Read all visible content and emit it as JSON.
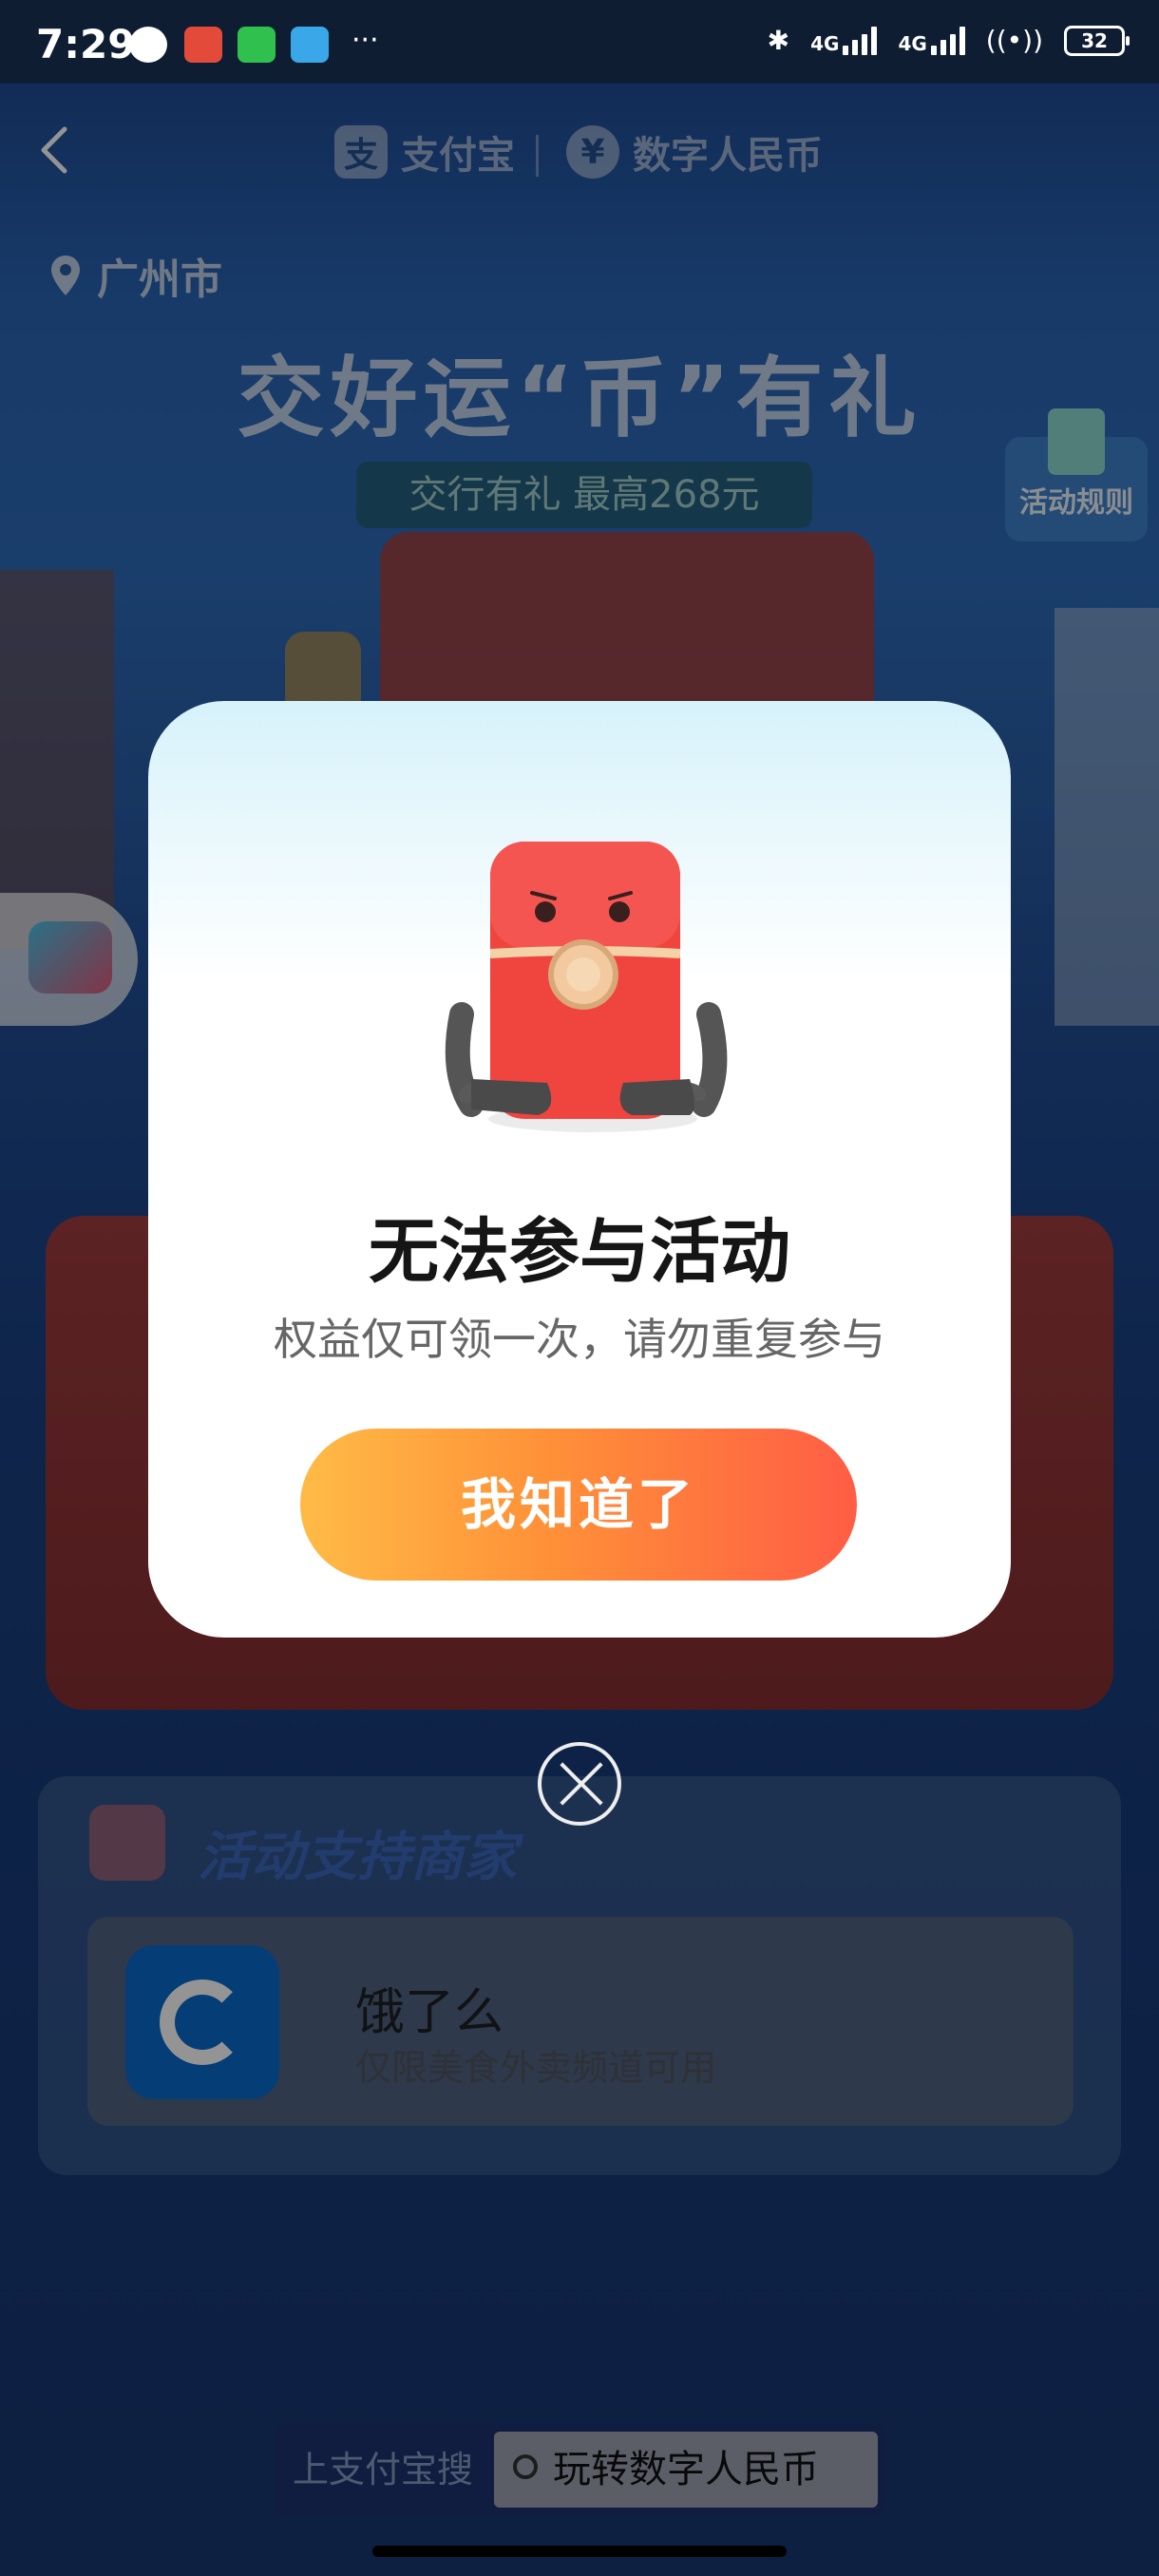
{
  "status_bar": {
    "time": "7:29",
    "network_1": "4G",
    "network_2": "4G",
    "battery": "32"
  },
  "header": {
    "alipay": "支付宝",
    "dcep": "数字人民币",
    "alipay_logo": "支",
    "dcep_logo": "¥"
  },
  "location": "广州市",
  "hero": {
    "title": "交好运“币”有礼",
    "subtitle": "交行有礼 最高268元"
  },
  "rules_label": "活动规则",
  "merchants": {
    "section_title": "活动支持商家",
    "items": [
      {
        "name": "饿了么",
        "desc": "仅限美食外卖频道可用"
      }
    ]
  },
  "bottom_search": {
    "label": "上支付宝搜",
    "query": "玩转数字人民币"
  },
  "modal": {
    "title": "无法参与活动",
    "subtitle": "权益仅可领一次，请勿重复参与",
    "button": "我知道了"
  },
  "colors": {
    "button_start": "#ffbb46",
    "button_end": "#ff5d45",
    "status_bar": "#0f1d33"
  }
}
